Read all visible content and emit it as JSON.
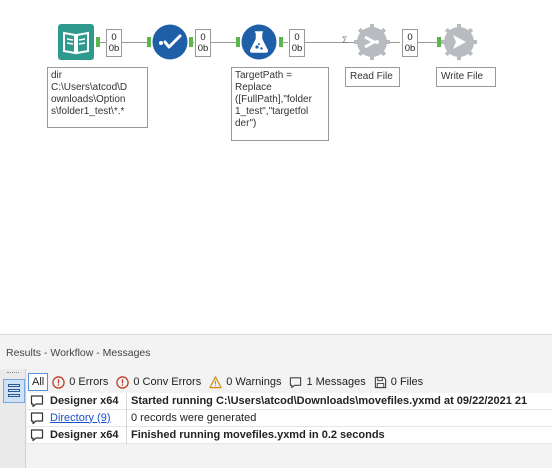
{
  "canvas": {
    "tools": [
      {
        "name": "directory-tool",
        "badge_top": "0",
        "badge_bottom": "0b"
      },
      {
        "name": "select-tool",
        "badge_top": "0",
        "badge_bottom": "0b"
      },
      {
        "name": "formula-tool",
        "badge_top": "0",
        "badge_bottom": "0b"
      },
      {
        "name": "read-file-tool",
        "badge_top": "0",
        "badge_bottom": "0b"
      },
      {
        "name": "write-file-tool"
      }
    ],
    "annotations": {
      "directory": "dir\nC:\\Users\\atcod\\D\nownloads\\Option\ns\\folder1_test\\*.*",
      "formula": "TargetPath =\nReplace\n([FullPath],\"folder\n1_test\",\"targetfol\nder\")",
      "read_file": "Read File",
      "write_file": "Write File"
    }
  },
  "results": {
    "title": "Results - Workflow - Messages",
    "filters": {
      "all": "All",
      "errors": "0 Errors",
      "conv_errors": "0 Conv Errors",
      "warnings": "0 Warnings",
      "messages": "1 Messages",
      "files": "0 Files"
    },
    "messages": [
      {
        "tool": "Designer x64",
        "tool_link": false,
        "text": "Started running C:\\Users\\atcod\\Downloads\\movefiles.yxmd at 09/22/2021 21",
        "bold": true
      },
      {
        "tool": "Directory (9)",
        "tool_link": true,
        "text": "0 records were generated",
        "bold": false
      },
      {
        "tool": "Designer x64",
        "tool_link": false,
        "text": "Finished running movefiles.yxmd in 0.2 seconds",
        "bold": true
      }
    ]
  },
  "colors": {
    "directory": "#2e9a8e",
    "select": "#1f5fa8",
    "formula": "#1f5fa8",
    "io_gray": "#b8bcc0",
    "anchor_green": "#5ab84b",
    "link": "#1a4fcf"
  }
}
